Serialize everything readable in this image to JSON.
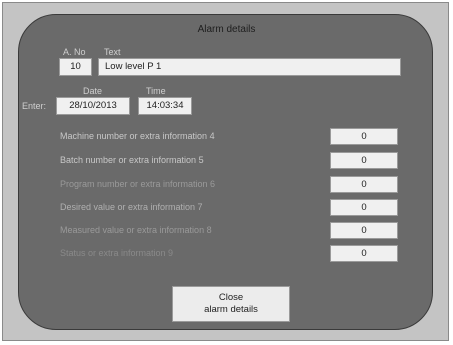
{
  "title": "Alarm details",
  "alarm": {
    "number_label": "A. No",
    "number_value": "10",
    "text_label": "Text",
    "text_value": "Low level P 1"
  },
  "occurrence": {
    "enter_label": "Enter:",
    "date_label": "Date",
    "date_value": "28/10/2013",
    "time_label": "Time",
    "time_value": "14:03:34"
  },
  "info_rows": [
    {
      "label": "Machine number or extra information 4",
      "value": "0",
      "color": "#c8c8c8"
    },
    {
      "label": "Batch number or extra information 5",
      "value": "0",
      "color": "#c8c8c8"
    },
    {
      "label": "Program number or extra information 6",
      "value": "0",
      "color": "#9a9a9a"
    },
    {
      "label": "Desired value or extra information 7",
      "value": "0",
      "color": "#b0b0b0"
    },
    {
      "label": "Measured value or extra information 8",
      "value": "0",
      "color": "#9a9a9a"
    },
    {
      "label": "Status or extra information 9",
      "value": "0",
      "color": "#8a8a8a"
    }
  ],
  "close_button": {
    "line1": "Close",
    "line2": "alarm details"
  }
}
